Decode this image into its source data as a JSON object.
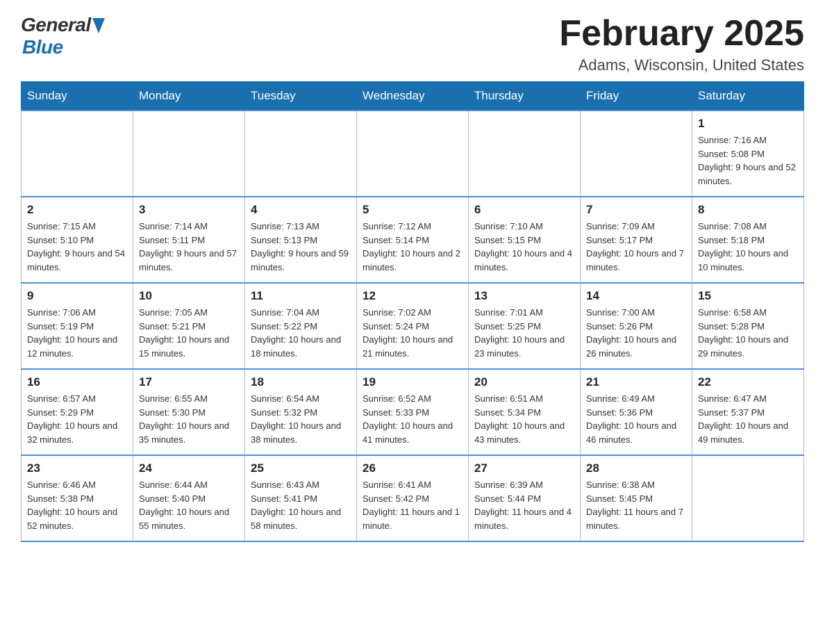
{
  "header": {
    "logo": {
      "general": "General",
      "blue": "Blue"
    },
    "title": "February 2025",
    "location": "Adams, Wisconsin, United States"
  },
  "weekdays": [
    "Sunday",
    "Monday",
    "Tuesday",
    "Wednesday",
    "Thursday",
    "Friday",
    "Saturday"
  ],
  "weeks": [
    [
      {
        "day": "",
        "info": ""
      },
      {
        "day": "",
        "info": ""
      },
      {
        "day": "",
        "info": ""
      },
      {
        "day": "",
        "info": ""
      },
      {
        "day": "",
        "info": ""
      },
      {
        "day": "",
        "info": ""
      },
      {
        "day": "1",
        "info": "Sunrise: 7:16 AM\nSunset: 5:08 PM\nDaylight: 9 hours and 52 minutes."
      }
    ],
    [
      {
        "day": "2",
        "info": "Sunrise: 7:15 AM\nSunset: 5:10 PM\nDaylight: 9 hours and 54 minutes."
      },
      {
        "day": "3",
        "info": "Sunrise: 7:14 AM\nSunset: 5:11 PM\nDaylight: 9 hours and 57 minutes."
      },
      {
        "day": "4",
        "info": "Sunrise: 7:13 AM\nSunset: 5:13 PM\nDaylight: 9 hours and 59 minutes."
      },
      {
        "day": "5",
        "info": "Sunrise: 7:12 AM\nSunset: 5:14 PM\nDaylight: 10 hours and 2 minutes."
      },
      {
        "day": "6",
        "info": "Sunrise: 7:10 AM\nSunset: 5:15 PM\nDaylight: 10 hours and 4 minutes."
      },
      {
        "day": "7",
        "info": "Sunrise: 7:09 AM\nSunset: 5:17 PM\nDaylight: 10 hours and 7 minutes."
      },
      {
        "day": "8",
        "info": "Sunrise: 7:08 AM\nSunset: 5:18 PM\nDaylight: 10 hours and 10 minutes."
      }
    ],
    [
      {
        "day": "9",
        "info": "Sunrise: 7:06 AM\nSunset: 5:19 PM\nDaylight: 10 hours and 12 minutes."
      },
      {
        "day": "10",
        "info": "Sunrise: 7:05 AM\nSunset: 5:21 PM\nDaylight: 10 hours and 15 minutes."
      },
      {
        "day": "11",
        "info": "Sunrise: 7:04 AM\nSunset: 5:22 PM\nDaylight: 10 hours and 18 minutes."
      },
      {
        "day": "12",
        "info": "Sunrise: 7:02 AM\nSunset: 5:24 PM\nDaylight: 10 hours and 21 minutes."
      },
      {
        "day": "13",
        "info": "Sunrise: 7:01 AM\nSunset: 5:25 PM\nDaylight: 10 hours and 23 minutes."
      },
      {
        "day": "14",
        "info": "Sunrise: 7:00 AM\nSunset: 5:26 PM\nDaylight: 10 hours and 26 minutes."
      },
      {
        "day": "15",
        "info": "Sunrise: 6:58 AM\nSunset: 5:28 PM\nDaylight: 10 hours and 29 minutes."
      }
    ],
    [
      {
        "day": "16",
        "info": "Sunrise: 6:57 AM\nSunset: 5:29 PM\nDaylight: 10 hours and 32 minutes."
      },
      {
        "day": "17",
        "info": "Sunrise: 6:55 AM\nSunset: 5:30 PM\nDaylight: 10 hours and 35 minutes."
      },
      {
        "day": "18",
        "info": "Sunrise: 6:54 AM\nSunset: 5:32 PM\nDaylight: 10 hours and 38 minutes."
      },
      {
        "day": "19",
        "info": "Sunrise: 6:52 AM\nSunset: 5:33 PM\nDaylight: 10 hours and 41 minutes."
      },
      {
        "day": "20",
        "info": "Sunrise: 6:51 AM\nSunset: 5:34 PM\nDaylight: 10 hours and 43 minutes."
      },
      {
        "day": "21",
        "info": "Sunrise: 6:49 AM\nSunset: 5:36 PM\nDaylight: 10 hours and 46 minutes."
      },
      {
        "day": "22",
        "info": "Sunrise: 6:47 AM\nSunset: 5:37 PM\nDaylight: 10 hours and 49 minutes."
      }
    ],
    [
      {
        "day": "23",
        "info": "Sunrise: 6:46 AM\nSunset: 5:38 PM\nDaylight: 10 hours and 52 minutes."
      },
      {
        "day": "24",
        "info": "Sunrise: 6:44 AM\nSunset: 5:40 PM\nDaylight: 10 hours and 55 minutes."
      },
      {
        "day": "25",
        "info": "Sunrise: 6:43 AM\nSunset: 5:41 PM\nDaylight: 10 hours and 58 minutes."
      },
      {
        "day": "26",
        "info": "Sunrise: 6:41 AM\nSunset: 5:42 PM\nDaylight: 11 hours and 1 minute."
      },
      {
        "day": "27",
        "info": "Sunrise: 6:39 AM\nSunset: 5:44 PM\nDaylight: 11 hours and 4 minutes."
      },
      {
        "day": "28",
        "info": "Sunrise: 6:38 AM\nSunset: 5:45 PM\nDaylight: 11 hours and 7 minutes."
      },
      {
        "day": "",
        "info": ""
      }
    ]
  ]
}
